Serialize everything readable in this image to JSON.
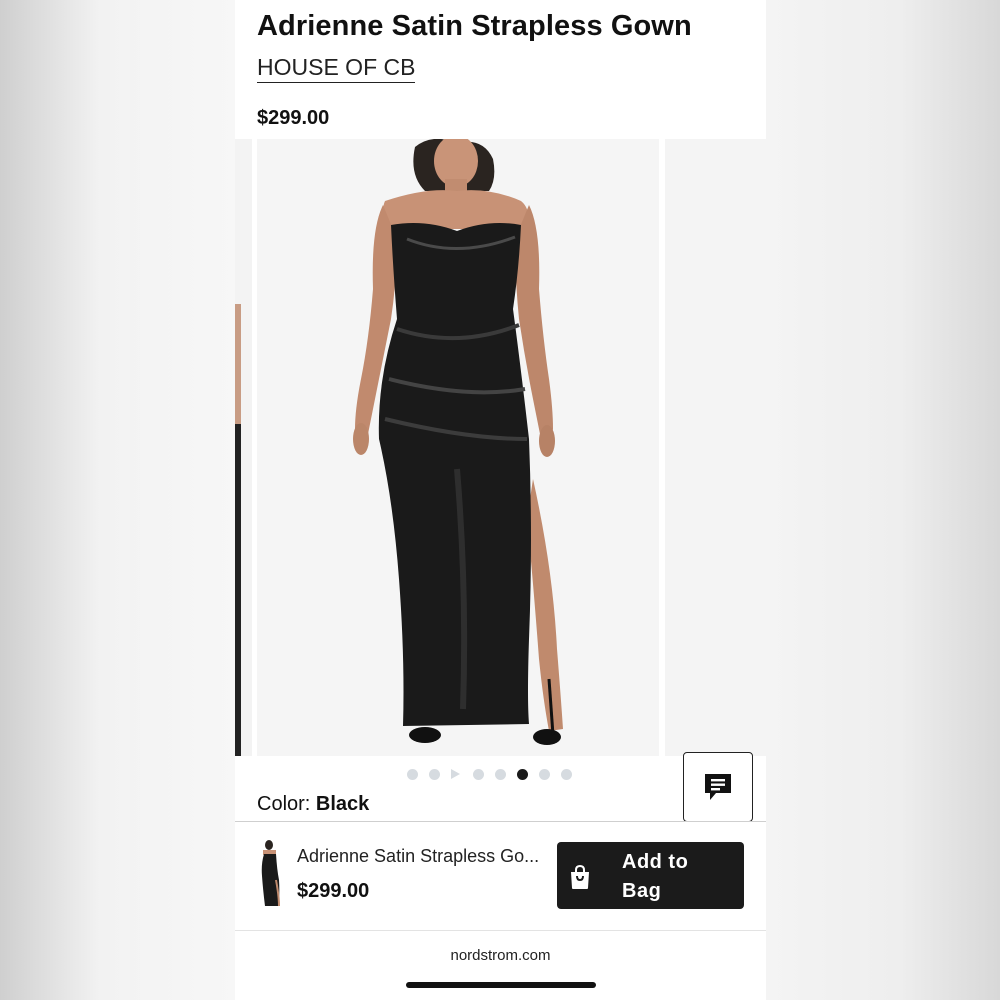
{
  "product": {
    "title": "Adrienne Satin Strapless Gown",
    "brand": "HOUSE OF CB",
    "price": "$299.00"
  },
  "gallery": {
    "image_count": 8,
    "active_index": 5,
    "video_index": 2,
    "main_image_alt": "model wearing black satin strapless gown"
  },
  "color": {
    "label": "Color:",
    "value": "Black"
  },
  "sticky_bar": {
    "name": "Adrienne Satin Strapless Go...",
    "price": "$299.00",
    "add_line1": "Add to",
    "add_line2": "Bag"
  },
  "footer": {
    "domain": "nordstrom.com"
  },
  "icons": {
    "chat": "chat-icon",
    "bag": "shopping-bag-icon"
  },
  "colors": {
    "button_bg": "#1b1b1b",
    "active_dot": "#1a1a1a",
    "inactive_dot": "#d6dbe0"
  }
}
